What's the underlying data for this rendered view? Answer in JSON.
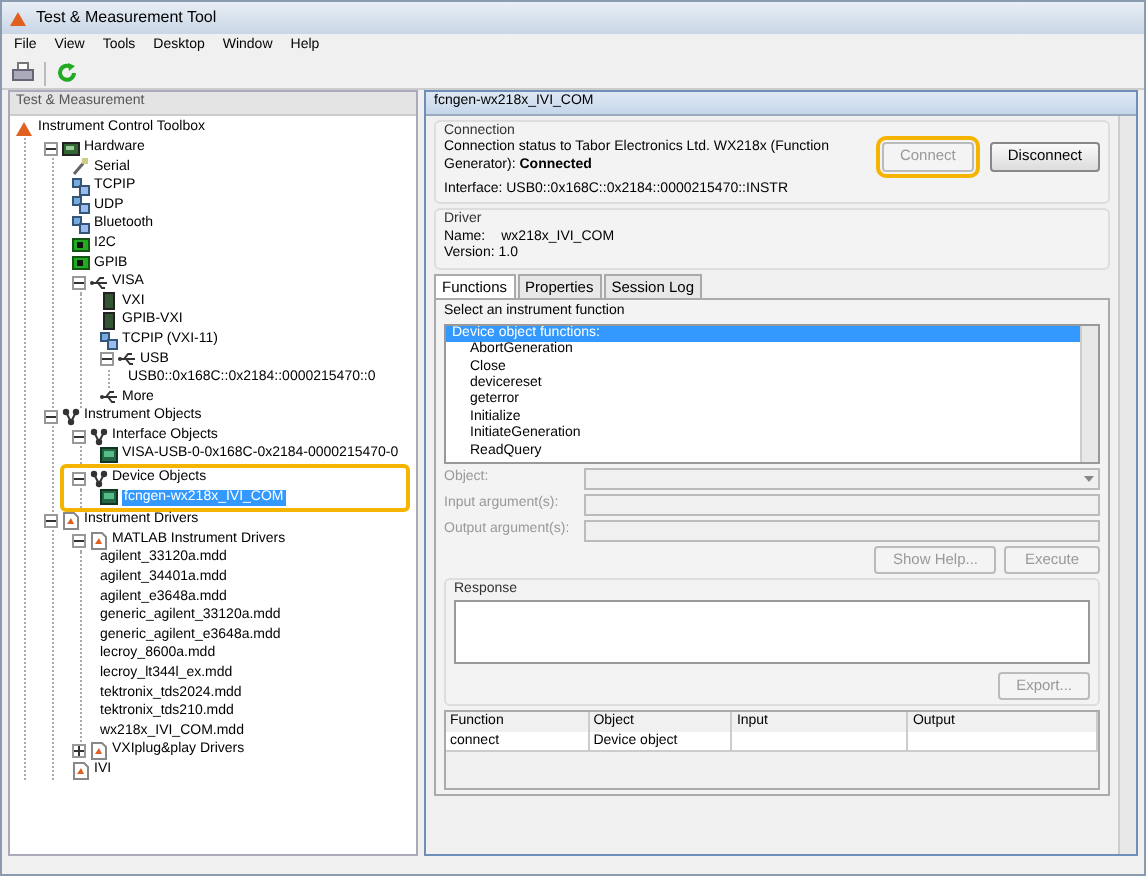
{
  "window": {
    "title": "Test & Measurement Tool"
  },
  "menu": [
    "File",
    "View",
    "Tools",
    "Desktop",
    "Window",
    "Help"
  ],
  "left_panel": {
    "title": "Test & Measurement",
    "tree": [
      {
        "label": "Instrument Control Toolbox",
        "kind": "toolbox",
        "selected": false,
        "highlighted": false,
        "children": [
          {
            "label": "Hardware",
            "kind": "hardware",
            "expanded": true,
            "selected": false,
            "highlighted": false,
            "children": [
              {
                "label": "Serial",
                "kind": "serial",
                "selected": false,
                "highlighted": false
              },
              {
                "label": "TCPIP",
                "kind": "network",
                "selected": false,
                "highlighted": false
              },
              {
                "label": "UDP",
                "kind": "network",
                "selected": false,
                "highlighted": false
              },
              {
                "label": "Bluetooth",
                "kind": "network",
                "selected": false,
                "highlighted": false
              },
              {
                "label": "I2C",
                "kind": "chip",
                "selected": false,
                "highlighted": false
              },
              {
                "label": "GPIB",
                "kind": "chip",
                "selected": false,
                "highlighted": false
              },
              {
                "label": "VISA",
                "kind": "visa",
                "expanded": true,
                "selected": false,
                "highlighted": false,
                "children": [
                  {
                    "label": "VXI",
                    "kind": "vxi",
                    "selected": false,
                    "highlighted": false
                  },
                  {
                    "label": "GPIB-VXI",
                    "kind": "vxi",
                    "selected": false,
                    "highlighted": false
                  },
                  {
                    "label": "TCPIP (VXI-11)",
                    "kind": "network",
                    "selected": false,
                    "highlighted": false
                  },
                  {
                    "label": "USB",
                    "kind": "visa",
                    "expanded": true,
                    "selected": false,
                    "highlighted": false,
                    "children": [
                      {
                        "label": "USB0::0x168C::0x2184::0000215470::0",
                        "selected": false,
                        "highlighted": false
                      }
                    ]
                  },
                  {
                    "label": "More",
                    "kind": "visa",
                    "selected": false,
                    "highlighted": false
                  }
                ]
              }
            ]
          },
          {
            "label": "Instrument Objects",
            "kind": "objects",
            "expanded": true,
            "selected": false,
            "highlighted": false,
            "children": [
              {
                "label": "Interface Objects",
                "kind": "objects",
                "expanded": true,
                "selected": false,
                "highlighted": false,
                "children": [
                  {
                    "label": "VISA-USB-0-0x168C-0x2184-0000215470-0",
                    "kind": "device",
                    "selected": false,
                    "highlighted": false
                  }
                ]
              },
              {
                "label": "Device Objects",
                "kind": "objects",
                "expanded": true,
                "selected": false,
                "highlighted": true,
                "children": [
                  {
                    "label": "fcngen-wx218x_IVI_COM",
                    "kind": "device",
                    "selected": true,
                    "highlighted": false
                  }
                ]
              }
            ]
          },
          {
            "label": "Instrument Drivers",
            "kind": "driver",
            "expanded": true,
            "selected": false,
            "highlighted": false,
            "children": [
              {
                "label": "MATLAB Instrument Drivers",
                "kind": "driver",
                "expanded": true,
                "selected": false,
                "highlighted": false,
                "children": [
                  {
                    "label": "agilent_33120a.mdd",
                    "selected": false,
                    "highlighted": false
                  },
                  {
                    "label": "agilent_34401a.mdd",
                    "selected": false,
                    "highlighted": false
                  },
                  {
                    "label": "agilent_e3648a.mdd",
                    "selected": false,
                    "highlighted": false
                  },
                  {
                    "label": "generic_agilent_33120a.mdd",
                    "selected": false,
                    "highlighted": false
                  },
                  {
                    "label": "generic_agilent_e3648a.mdd",
                    "selected": false,
                    "highlighted": false
                  },
                  {
                    "label": "lecroy_8600a.mdd",
                    "selected": false,
                    "highlighted": false
                  },
                  {
                    "label": "lecroy_lt344l_ex.mdd",
                    "selected": false,
                    "highlighted": false
                  },
                  {
                    "label": "tektronix_tds2024.mdd",
                    "selected": false,
                    "highlighted": false
                  },
                  {
                    "label": "tektronix_tds210.mdd",
                    "selected": false,
                    "highlighted": false
                  },
                  {
                    "label": "wx218x_IVI_COM.mdd",
                    "selected": false,
                    "highlighted": false
                  }
                ]
              },
              {
                "label": "VXIplug&play Drivers",
                "kind": "driver",
                "expanded": false,
                "selected": false,
                "highlighted": false
              },
              {
                "label": "IVI",
                "kind": "driver",
                "selected": false,
                "highlighted": false
              }
            ]
          }
        ]
      }
    ]
  },
  "right_panel": {
    "title": "fcngen-wx218x_IVI_COM",
    "connection": {
      "title": "Connection",
      "status": "Connection status to Tabor Electronics Ltd. WX218x (Function Generator): **Connected**",
      "interface": "Interface: USB0::0x168C::0x2184::0000215470::INSTR",
      "buttons": [
        {
          "label": "Connect",
          "disabled": true,
          "highlighted": true
        },
        {
          "label": "Disconnect",
          "disabled": false,
          "highlighted": false
        }
      ]
    },
    "driver": {
      "title": "Driver",
      "name_label": "Name:",
      "name": "wx218x_IVI_COM",
      "version": "Version: 1.0"
    },
    "tabs": [
      {
        "label": "Functions",
        "selected": true
      },
      {
        "label": "Properties",
        "selected": false
      },
      {
        "label": "Session Log",
        "selected": false
      }
    ],
    "functions": {
      "heading": "Select an instrument function",
      "items": [
        {
          "label": "Device object functions:",
          "selected": true
        },
        {
          "label": "AbortGeneration",
          "selected": false
        },
        {
          "label": "Close",
          "selected": false
        },
        {
          "label": "devicereset",
          "selected": false
        },
        {
          "label": "geterror",
          "selected": false
        },
        {
          "label": "Initialize",
          "selected": false
        },
        {
          "label": "InitiateGeneration",
          "selected": false
        },
        {
          "label": "ReadQuery",
          "selected": false
        }
      ]
    },
    "fields": [
      {
        "label": "Object:",
        "kind": "dropdown",
        "disabled": true
      },
      {
        "label": "Input argument(s):",
        "kind": "text",
        "disabled": true
      },
      {
        "label": "Output argument(s):",
        "kind": "text",
        "disabled": true
      }
    ],
    "action_buttons": [
      {
        "label": "Show Help...",
        "disabled": true
      },
      {
        "label": "Execute",
        "disabled": true
      }
    ],
    "response": {
      "title": "Response",
      "export": {
        "label": "Export...",
        "disabled": true
      }
    },
    "table": {
      "columns": [
        "Function",
        "Object",
        "Input",
        "Output"
      ],
      "rows": [
        [
          "connect",
          "Device object"
        ]
      ]
    }
  }
}
